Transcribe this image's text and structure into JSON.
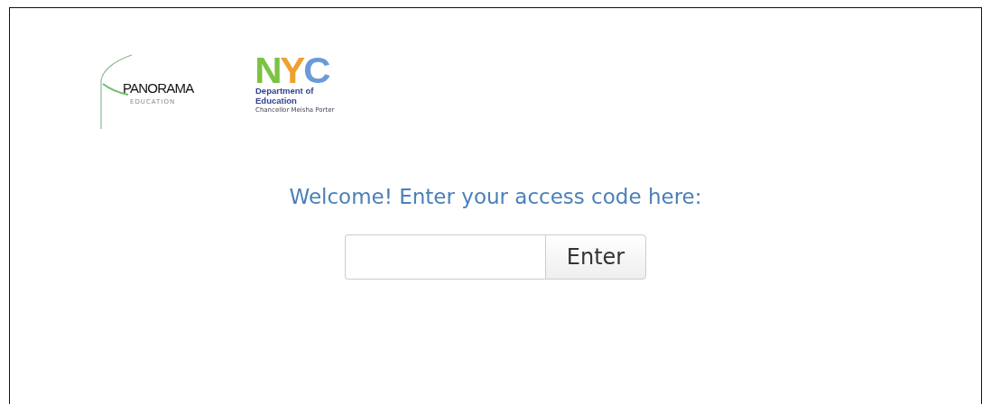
{
  "logos": {
    "panorama": {
      "name": "PANORAMA",
      "tagline": "EDUCATION"
    },
    "nyc": {
      "letters": [
        {
          "text": "N",
          "color": "#7cc243"
        },
        {
          "text": "Y",
          "color": "#f0a030"
        },
        {
          "text": "C",
          "color": "#6a9bd8"
        }
      ],
      "line_1": "Department of",
      "line_2": "Education",
      "line_3": "Chancellor Meisha Porter"
    }
  },
  "heading": "Welcome! Enter your access code here:",
  "access_form": {
    "button": "Enter"
  }
}
